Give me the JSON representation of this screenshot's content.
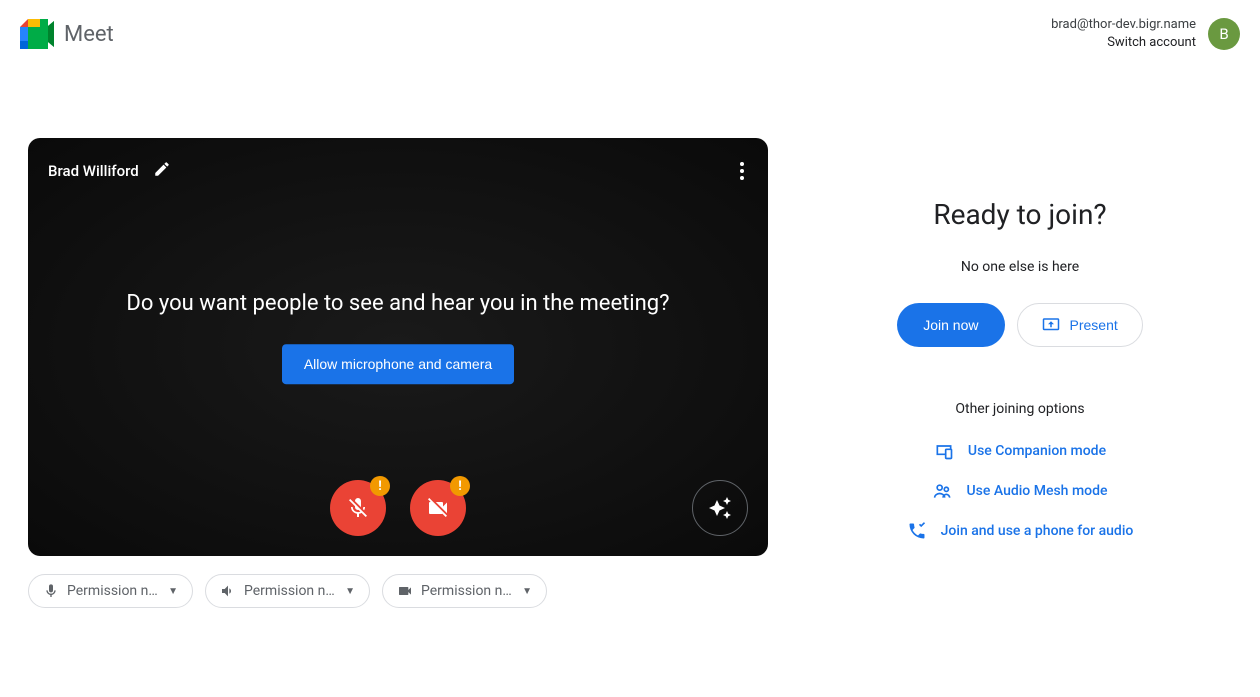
{
  "header": {
    "product_name": "Meet",
    "user_email": "brad@thor-dev.bigr.name",
    "switch_account": "Switch account",
    "avatar_initial": "B"
  },
  "preview": {
    "user_name": "Brad Williford",
    "prompt_heading": "Do you want people to see and hear you in the meeting?",
    "allow_button": "Allow microphone and camera"
  },
  "devices": {
    "mic_label": "Permission ne…",
    "speaker_label": "Permission ne…",
    "camera_label": "Permission ne…"
  },
  "join": {
    "title": "Ready to join?",
    "subtitle": "No one else is here",
    "join_now": "Join now",
    "present": "Present",
    "other_heading": "Other joining options",
    "companion": "Use Companion mode",
    "audio_mesh": "Use Audio Mesh mode",
    "phone": "Join and use a phone for audio"
  }
}
